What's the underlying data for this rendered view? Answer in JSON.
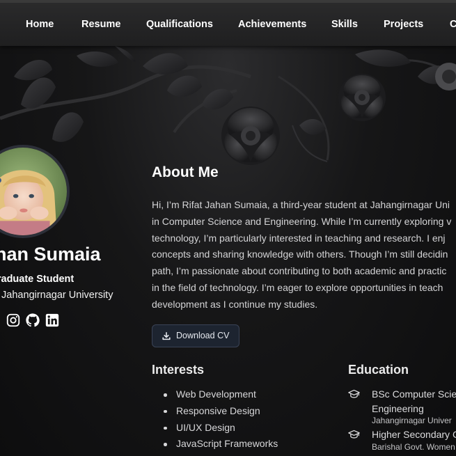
{
  "nav": {
    "items": [
      "Home",
      "Resume",
      "Qualifications",
      "Achievements",
      "Skills",
      "Projects",
      "Co"
    ]
  },
  "profile": {
    "name": "ahan Sumaia",
    "role": "graduate Student",
    "affiliation": ", Jahangirnagar University",
    "socials": [
      "instagram-icon",
      "github-icon",
      "linkedin-icon"
    ]
  },
  "about": {
    "title": "About Me",
    "lines": [
      "Hi, I’m Rifat Jahan Sumaia, a third-year student at Jahangirnagar Uni",
      "in Computer Science and Engineering. While I’m currently exploring v",
      "technology, I’m particularly interested in teaching and research. I enj",
      "concepts and sharing knowledge with others. Though I’m still decidin",
      "path, I’m passionate about contributing to both academic and practic",
      "in the field of technology. I’m eager to explore opportunities in teach",
      "development as I continue my studies."
    ],
    "download_label": "Download CV"
  },
  "interests": {
    "title": "Interests",
    "items": [
      "Web Development",
      "Responsive Design",
      "UI/UX Design",
      "JavaScript Frameworks"
    ]
  },
  "education": {
    "title": "Education",
    "items": [
      {
        "degree_line1": "BSc Computer Scie",
        "degree_line2": "Engineering",
        "school": "Jahangirnagar Univer"
      },
      {
        "degree_line1": "Higher Secondary C",
        "degree_line2": "",
        "school": "Barishal Govt. Women"
      }
    ]
  },
  "colors": {
    "background": "#0e0e0f",
    "nav": "#242425",
    "button": "#1d2430",
    "button_border": "#3a4356"
  }
}
